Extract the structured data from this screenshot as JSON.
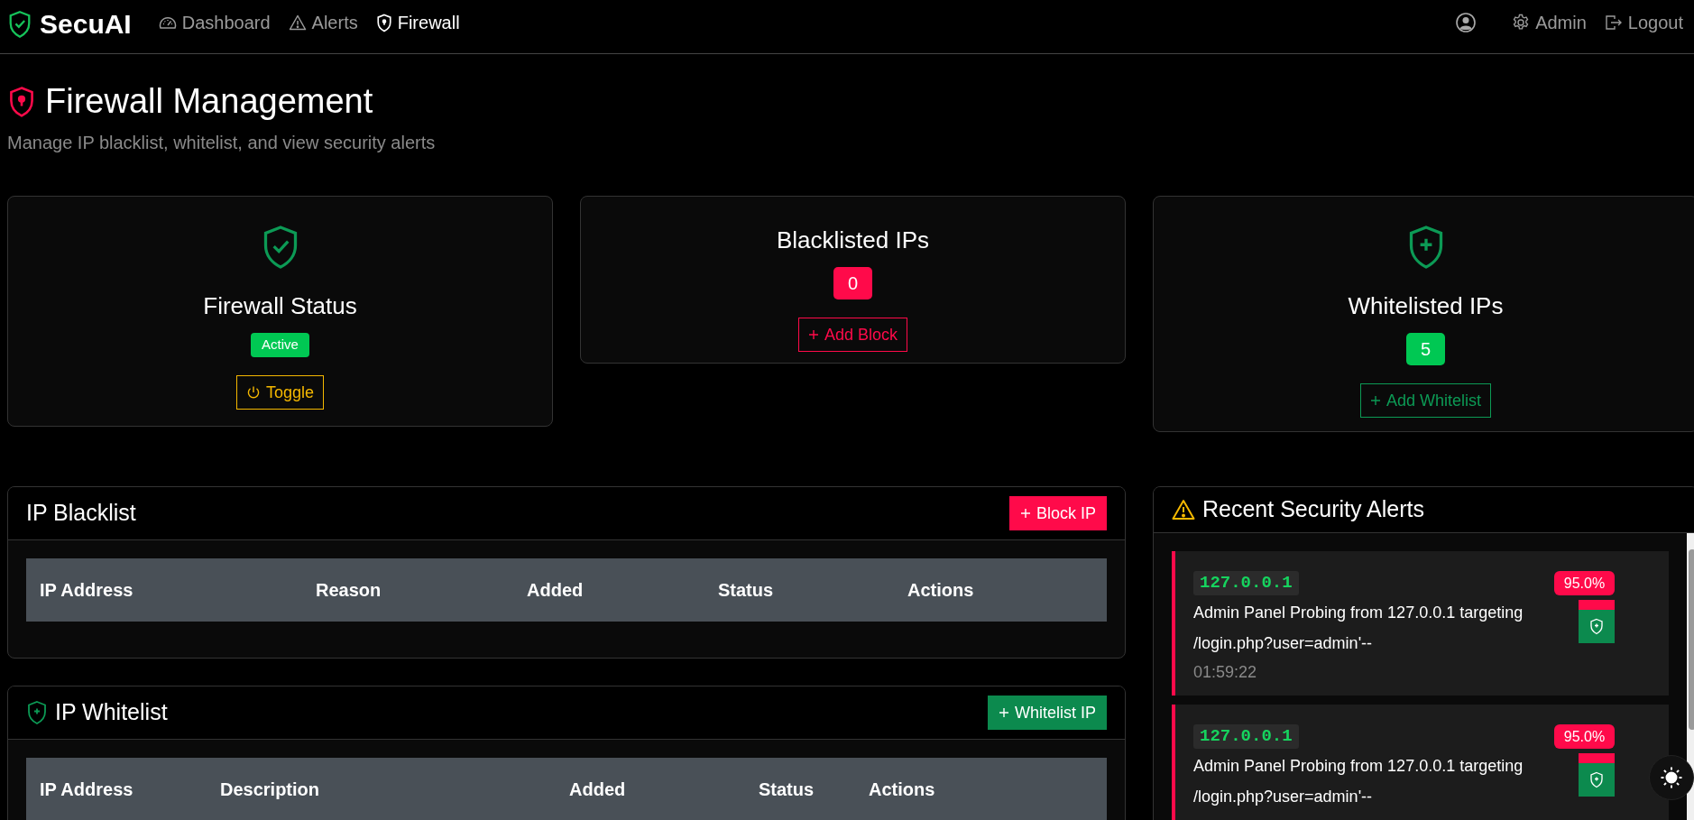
{
  "brand": "SecuAI",
  "nav": [
    {
      "label": "Dashboard",
      "selected": false
    },
    {
      "label": "Alerts",
      "selected": false
    },
    {
      "label": "Firewall",
      "selected": true
    }
  ],
  "user_menu": [
    {
      "label": "Admin"
    },
    {
      "label": "Logout"
    }
  ],
  "page": {
    "title": "Firewall Management",
    "subtitle": "Manage IP blacklist, whitelist, and view security alerts"
  },
  "cards": [
    {
      "kind": "status",
      "title": "Firewall Status",
      "badge": "Active",
      "button": "Toggle"
    },
    {
      "kind": "blacklist",
      "title": "Blacklisted IPs",
      "badge": "0",
      "button": "Add Block"
    },
    {
      "kind": "whitelist",
      "title": "Whitelisted IPs",
      "badge": "5",
      "button": "Add Whitelist"
    }
  ],
  "blacklist": {
    "title": "IP Blacklist",
    "button": "Block IP",
    "columns": [
      "IP Address",
      "Reason",
      "Added",
      "Status",
      "Actions"
    ]
  },
  "whitelist": {
    "title": "IP Whitelist",
    "button": "Whitelist IP",
    "columns": [
      "IP Address",
      "Description",
      "Added",
      "Status",
      "Actions"
    ]
  },
  "alerts": {
    "title": "Recent Security Alerts",
    "items": [
      {
        "ip": "127.0.0.1",
        "message": "Admin Panel Probing from 127.0.0.1 targeting /login.php?user=admin'--",
        "time": "01:59:22",
        "confidence": "95.0%"
      },
      {
        "ip": "127.0.0.1",
        "message": "Admin Panel Probing from 127.0.0.1 targeting /login.php?user=admin'--",
        "confidence": "95.0%"
      }
    ]
  }
}
